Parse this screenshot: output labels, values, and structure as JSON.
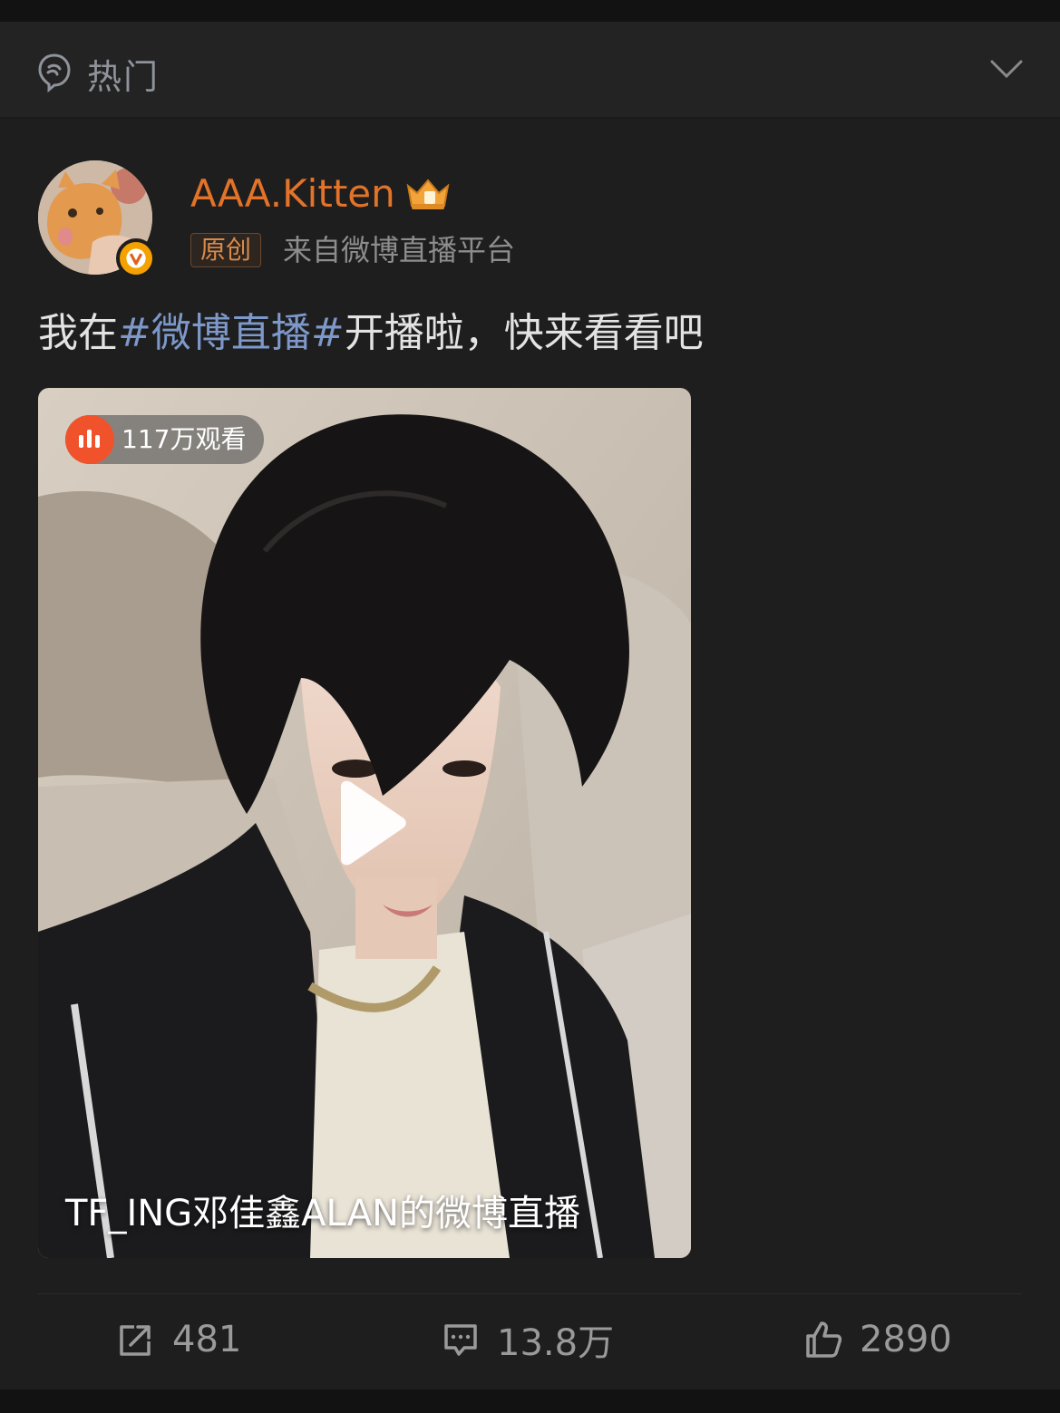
{
  "header": {
    "title": "热门",
    "icon": "hot-icon"
  },
  "post": {
    "username": "AAA.Kitten",
    "badge_icon": "crown-badge-icon",
    "tag": "原创",
    "source": "来自微博直播平台",
    "text_before": "我在",
    "hashtag": "#微博直播#",
    "text_after": "开播啦，快来看看吧",
    "media": {
      "viewers": "117万观看",
      "caption": "TF_ING邓佳鑫ALAN的微博直播"
    }
  },
  "actions": {
    "repost_count": "481",
    "comment_count": "13.8万",
    "like_count": "2890"
  },
  "colors": {
    "background": "#1e1e1e",
    "username": "#e27328",
    "hashtag": "#7d98c9",
    "live": "#f0532b"
  }
}
